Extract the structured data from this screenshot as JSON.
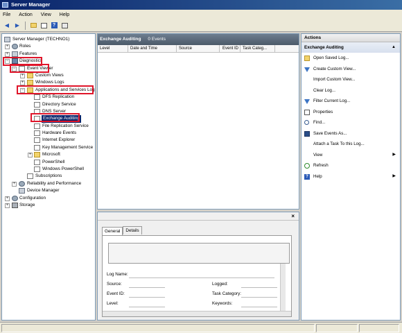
{
  "window": {
    "title": "Server Manager"
  },
  "menu": {
    "items": [
      "File",
      "Action",
      "View",
      "Help"
    ]
  },
  "toolbar": {
    "icons": [
      "back-arrow-icon",
      "forward-arrow-icon",
      "up-folder-icon",
      "show-hide-tree-icon",
      "help-icon",
      "show-hide-action-pane-icon"
    ]
  },
  "tree": {
    "items": [
      {
        "label": "Server Manager (TECHNO1)",
        "icon": "server-icon"
      },
      {
        "label": "Roles",
        "icon": "roles-icon"
      },
      {
        "label": "Features",
        "icon": "features-icon"
      },
      {
        "label": "Diagnostics",
        "icon": "diagnostics-icon"
      },
      {
        "label": "Event Viewer",
        "icon": "event-viewer-icon"
      },
      {
        "label": "Custom Views",
        "icon": "folder-icon"
      },
      {
        "label": "Windows Logs",
        "icon": "folder-icon"
      },
      {
        "label": "Applications and Services Logs",
        "icon": "folder-icon"
      },
      {
        "label": "DFS Replication",
        "icon": "log-icon"
      },
      {
        "label": "Directory Service",
        "icon": "log-icon"
      },
      {
        "label": "DNS Server",
        "icon": "log-icon"
      },
      {
        "label": "Exchange Auditing",
        "icon": "log-icon"
      },
      {
        "label": "File Replication Service",
        "icon": "log-icon"
      },
      {
        "label": "Hardware Events",
        "icon": "log-icon"
      },
      {
        "label": "Internet Explorer",
        "icon": "log-icon"
      },
      {
        "label": "Key Management Service",
        "icon": "log-icon"
      },
      {
        "label": "Microsoft",
        "icon": "folder-icon"
      },
      {
        "label": "PowerShell",
        "icon": "log-icon"
      },
      {
        "label": "Windows PowerShell",
        "icon": "log-icon"
      },
      {
        "label": "Subscriptions",
        "icon": "subscriptions-icon"
      },
      {
        "label": "Reliability and Performance",
        "icon": "performance-icon"
      },
      {
        "label": "Device Manager",
        "icon": "device-manager-icon"
      },
      {
        "label": "Configuration",
        "icon": "configuration-icon"
      },
      {
        "label": "Storage",
        "icon": "storage-icon"
      }
    ]
  },
  "log_view": {
    "title": "Exchange Auditing",
    "count": "0 Events",
    "columns": [
      "Level",
      "Date and Time",
      "Source",
      "Event ID",
      "Task Categ..."
    ]
  },
  "details": {
    "tabs": [
      "General",
      "Details"
    ],
    "fields": {
      "log_name": "Log Name:",
      "source": "Source:",
      "event_id": "Event ID:",
      "level": "Level:",
      "logged": "Logged:",
      "task_category": "Task Category:",
      "keywords": "Keywords:"
    }
  },
  "actions": {
    "header": "Actions",
    "section": "Exchange Auditing",
    "items": [
      {
        "label": "Open Saved Log...",
        "icon": "open-folder-icon"
      },
      {
        "label": "Create Custom View...",
        "icon": "filter-icon"
      },
      {
        "label": "Import Custom View...",
        "icon": ""
      },
      {
        "label": "Clear Log...",
        "icon": ""
      },
      {
        "label": "Filter Current Log...",
        "icon": "filter-icon"
      },
      {
        "label": "Properties",
        "icon": "properties-icon"
      },
      {
        "label": "Find...",
        "icon": "find-icon"
      },
      {
        "label": "Save Events As...",
        "icon": "save-icon"
      },
      {
        "label": "Attach a Task To this Log...",
        "icon": ""
      },
      {
        "label": "View",
        "icon": ""
      },
      {
        "label": "Refresh",
        "icon": "refresh-icon"
      },
      {
        "label": "Help",
        "icon": "help-icon"
      }
    ]
  },
  "colors": {
    "highlight_box": "#e0152a",
    "selection": "#0a246a",
    "title_bar": "#0a246a"
  }
}
